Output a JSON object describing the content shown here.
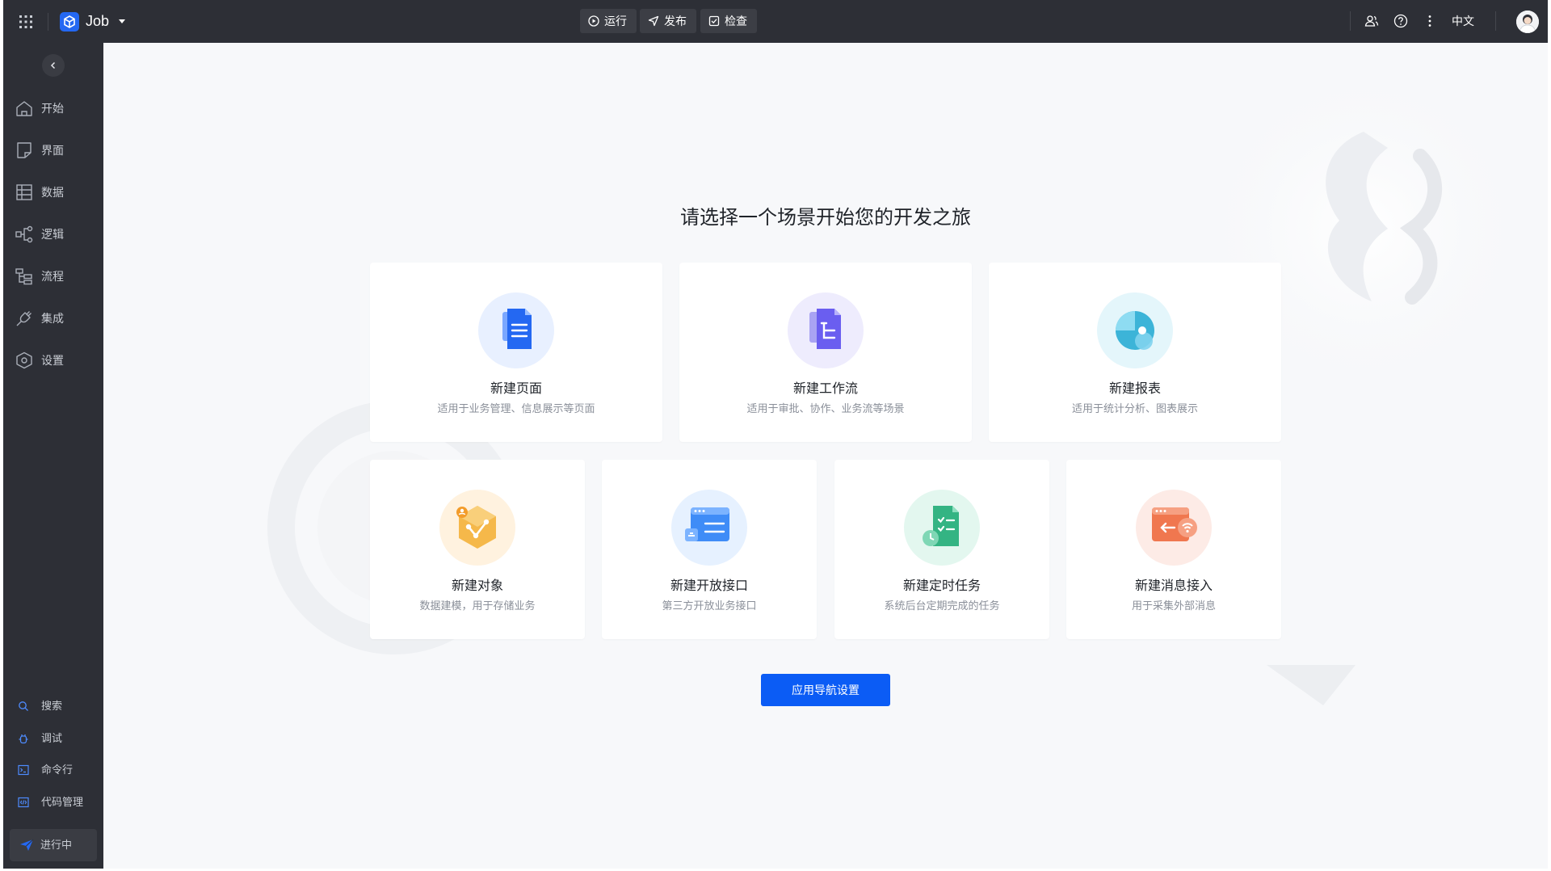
{
  "header": {
    "app_name": "Job",
    "actions": [
      {
        "label": "运行",
        "icon": "play-circle-icon"
      },
      {
        "label": "发布",
        "icon": "send-icon"
      },
      {
        "label": "检查",
        "icon": "check-square-icon"
      }
    ],
    "right_icons": [
      "users-icon",
      "help-circle-icon",
      "more-vertical-icon"
    ],
    "language": "中文"
  },
  "sidebar": {
    "items": [
      {
        "label": "开始",
        "icon": "home-icon"
      },
      {
        "label": "界面",
        "icon": "page-icon"
      },
      {
        "label": "数据",
        "icon": "table-icon"
      },
      {
        "label": "逻辑",
        "icon": "logic-icon"
      },
      {
        "label": "流程",
        "icon": "flow-icon"
      },
      {
        "label": "集成",
        "icon": "plug-icon"
      },
      {
        "label": "设置",
        "icon": "settings-icon"
      }
    ],
    "bottom_items": [
      {
        "label": "搜索",
        "icon": "search-icon"
      },
      {
        "label": "调试",
        "icon": "debug-icon"
      },
      {
        "label": "命令行",
        "icon": "terminal-icon"
      },
      {
        "label": "代码管理",
        "icon": "code-icon"
      }
    ],
    "running_label": "进行中"
  },
  "main": {
    "title": "请选择一个场景开始您的开发之旅",
    "cards_row1": [
      {
        "title": "新建页面",
        "desc": "适用于业务管理、信息展示等页面",
        "icon": "new-page-icon"
      },
      {
        "title": "新建工作流",
        "desc": "适用于审批、协作、业务流等场景",
        "icon": "new-workflow-icon"
      },
      {
        "title": "新建报表",
        "desc": "适用于统计分析、图表展示",
        "icon": "new-report-icon"
      }
    ],
    "cards_row2": [
      {
        "title": "新建对象",
        "desc": "数据建模，用于存储业务",
        "icon": "new-object-icon"
      },
      {
        "title": "新建开放接口",
        "desc": "第三方开放业务接口",
        "icon": "new-api-icon"
      },
      {
        "title": "新建定时任务",
        "desc": "系统后台定期完成的任务",
        "icon": "new-scheduled-task-icon"
      },
      {
        "title": "新建消息接入",
        "desc": "用于采集外部消息",
        "icon": "new-message-icon"
      }
    ],
    "nav_button": "应用导航设置"
  },
  "colors": {
    "topbar_bg": "#2d2f36",
    "primary": "#0b5cf5",
    "main_bg": "#f7f8fa"
  }
}
